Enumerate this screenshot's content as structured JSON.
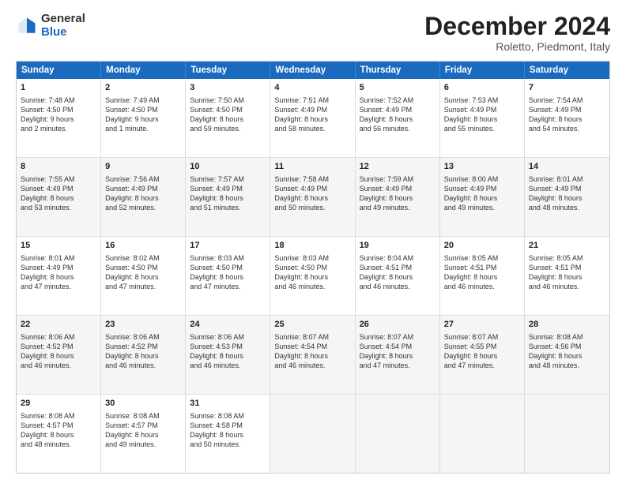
{
  "logo": {
    "general": "General",
    "blue": "Blue"
  },
  "title": "December 2024",
  "location": "Roletto, Piedmont, Italy",
  "header": {
    "days": [
      "Sunday",
      "Monday",
      "Tuesday",
      "Wednesday",
      "Thursday",
      "Friday",
      "Saturday"
    ]
  },
  "weeks": [
    [
      {
        "day": "1",
        "lines": [
          "Sunrise: 7:48 AM",
          "Sunset: 4:50 PM",
          "Daylight: 9 hours",
          "and 2 minutes."
        ],
        "shaded": false
      },
      {
        "day": "2",
        "lines": [
          "Sunrise: 7:49 AM",
          "Sunset: 4:50 PM",
          "Daylight: 9 hours",
          "and 1 minute."
        ],
        "shaded": false
      },
      {
        "day": "3",
        "lines": [
          "Sunrise: 7:50 AM",
          "Sunset: 4:50 PM",
          "Daylight: 8 hours",
          "and 59 minutes."
        ],
        "shaded": false
      },
      {
        "day": "4",
        "lines": [
          "Sunrise: 7:51 AM",
          "Sunset: 4:49 PM",
          "Daylight: 8 hours",
          "and 58 minutes."
        ],
        "shaded": false
      },
      {
        "day": "5",
        "lines": [
          "Sunrise: 7:52 AM",
          "Sunset: 4:49 PM",
          "Daylight: 8 hours",
          "and 56 minutes."
        ],
        "shaded": false
      },
      {
        "day": "6",
        "lines": [
          "Sunrise: 7:53 AM",
          "Sunset: 4:49 PM",
          "Daylight: 8 hours",
          "and 55 minutes."
        ],
        "shaded": false
      },
      {
        "day": "7",
        "lines": [
          "Sunrise: 7:54 AM",
          "Sunset: 4:49 PM",
          "Daylight: 8 hours",
          "and 54 minutes."
        ],
        "shaded": false
      }
    ],
    [
      {
        "day": "8",
        "lines": [
          "Sunrise: 7:55 AM",
          "Sunset: 4:49 PM",
          "Daylight: 8 hours",
          "and 53 minutes."
        ],
        "shaded": true
      },
      {
        "day": "9",
        "lines": [
          "Sunrise: 7:56 AM",
          "Sunset: 4:49 PM",
          "Daylight: 8 hours",
          "and 52 minutes."
        ],
        "shaded": true
      },
      {
        "day": "10",
        "lines": [
          "Sunrise: 7:57 AM",
          "Sunset: 4:49 PM",
          "Daylight: 8 hours",
          "and 51 minutes."
        ],
        "shaded": true
      },
      {
        "day": "11",
        "lines": [
          "Sunrise: 7:58 AM",
          "Sunset: 4:49 PM",
          "Daylight: 8 hours",
          "and 50 minutes."
        ],
        "shaded": true
      },
      {
        "day": "12",
        "lines": [
          "Sunrise: 7:59 AM",
          "Sunset: 4:49 PM",
          "Daylight: 8 hours",
          "and 49 minutes."
        ],
        "shaded": true
      },
      {
        "day": "13",
        "lines": [
          "Sunrise: 8:00 AM",
          "Sunset: 4:49 PM",
          "Daylight: 8 hours",
          "and 49 minutes."
        ],
        "shaded": true
      },
      {
        "day": "14",
        "lines": [
          "Sunrise: 8:01 AM",
          "Sunset: 4:49 PM",
          "Daylight: 8 hours",
          "and 48 minutes."
        ],
        "shaded": true
      }
    ],
    [
      {
        "day": "15",
        "lines": [
          "Sunrise: 8:01 AM",
          "Sunset: 4:49 PM",
          "Daylight: 8 hours",
          "and 47 minutes."
        ],
        "shaded": false
      },
      {
        "day": "16",
        "lines": [
          "Sunrise: 8:02 AM",
          "Sunset: 4:50 PM",
          "Daylight: 8 hours",
          "and 47 minutes."
        ],
        "shaded": false
      },
      {
        "day": "17",
        "lines": [
          "Sunrise: 8:03 AM",
          "Sunset: 4:50 PM",
          "Daylight: 8 hours",
          "and 47 minutes."
        ],
        "shaded": false
      },
      {
        "day": "18",
        "lines": [
          "Sunrise: 8:03 AM",
          "Sunset: 4:50 PM",
          "Daylight: 8 hours",
          "and 46 minutes."
        ],
        "shaded": false
      },
      {
        "day": "19",
        "lines": [
          "Sunrise: 8:04 AM",
          "Sunset: 4:51 PM",
          "Daylight: 8 hours",
          "and 46 minutes."
        ],
        "shaded": false
      },
      {
        "day": "20",
        "lines": [
          "Sunrise: 8:05 AM",
          "Sunset: 4:51 PM",
          "Daylight: 8 hours",
          "and 46 minutes."
        ],
        "shaded": false
      },
      {
        "day": "21",
        "lines": [
          "Sunrise: 8:05 AM",
          "Sunset: 4:51 PM",
          "Daylight: 8 hours",
          "and 46 minutes."
        ],
        "shaded": false
      }
    ],
    [
      {
        "day": "22",
        "lines": [
          "Sunrise: 8:06 AM",
          "Sunset: 4:52 PM",
          "Daylight: 8 hours",
          "and 46 minutes."
        ],
        "shaded": true
      },
      {
        "day": "23",
        "lines": [
          "Sunrise: 8:06 AM",
          "Sunset: 4:52 PM",
          "Daylight: 8 hours",
          "and 46 minutes."
        ],
        "shaded": true
      },
      {
        "day": "24",
        "lines": [
          "Sunrise: 8:06 AM",
          "Sunset: 4:53 PM",
          "Daylight: 8 hours",
          "and 46 minutes."
        ],
        "shaded": true
      },
      {
        "day": "25",
        "lines": [
          "Sunrise: 8:07 AM",
          "Sunset: 4:54 PM",
          "Daylight: 8 hours",
          "and 46 minutes."
        ],
        "shaded": true
      },
      {
        "day": "26",
        "lines": [
          "Sunrise: 8:07 AM",
          "Sunset: 4:54 PM",
          "Daylight: 8 hours",
          "and 47 minutes."
        ],
        "shaded": true
      },
      {
        "day": "27",
        "lines": [
          "Sunrise: 8:07 AM",
          "Sunset: 4:55 PM",
          "Daylight: 8 hours",
          "and 47 minutes."
        ],
        "shaded": true
      },
      {
        "day": "28",
        "lines": [
          "Sunrise: 8:08 AM",
          "Sunset: 4:56 PM",
          "Daylight: 8 hours",
          "and 48 minutes."
        ],
        "shaded": true
      }
    ],
    [
      {
        "day": "29",
        "lines": [
          "Sunrise: 8:08 AM",
          "Sunset: 4:57 PM",
          "Daylight: 8 hours",
          "and 48 minutes."
        ],
        "shaded": false
      },
      {
        "day": "30",
        "lines": [
          "Sunrise: 8:08 AM",
          "Sunset: 4:57 PM",
          "Daylight: 8 hours",
          "and 49 minutes."
        ],
        "shaded": false
      },
      {
        "day": "31",
        "lines": [
          "Sunrise: 8:08 AM",
          "Sunset: 4:58 PM",
          "Daylight: 8 hours",
          "and 50 minutes."
        ],
        "shaded": false
      },
      {
        "day": "",
        "lines": [],
        "shaded": true
      },
      {
        "day": "",
        "lines": [],
        "shaded": true
      },
      {
        "day": "",
        "lines": [],
        "shaded": true
      },
      {
        "day": "",
        "lines": [],
        "shaded": true
      }
    ]
  ]
}
